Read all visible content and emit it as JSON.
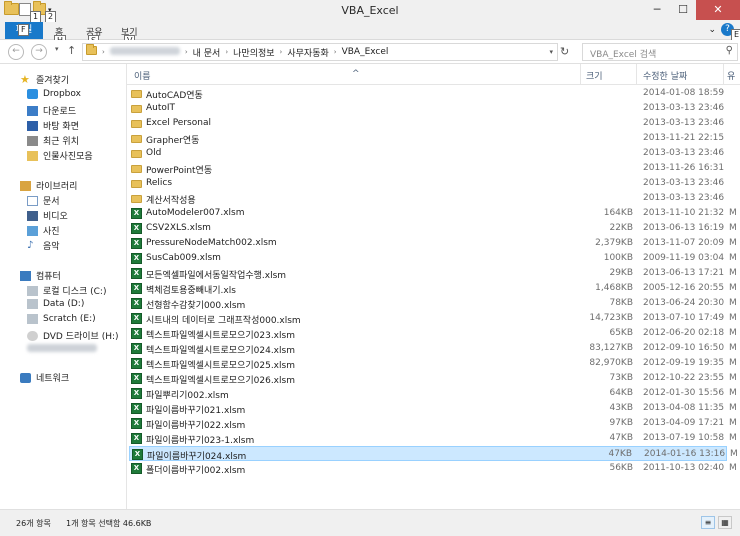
{
  "window": {
    "title": "VBA_Excel",
    "minimize": "─",
    "maximize": "☐",
    "close": "✕",
    "keytips": [
      "1",
      "2"
    ]
  },
  "ribbon": {
    "file_tab": "파일",
    "file_keytip": "F",
    "tabs": [
      {
        "label": "홈",
        "keytip": "H"
      },
      {
        "label": "공유",
        "keytip": "S"
      },
      {
        "label": "보기",
        "keytip": "V"
      }
    ],
    "help_keytip": "E"
  },
  "address": {
    "crumbs": [
      "내 문서",
      "나만의정보",
      "사무자동화",
      "VBA_Excel"
    ]
  },
  "search": {
    "placeholder": "VBA_Excel 검색"
  },
  "nav": {
    "favorites_header": "즐겨찾기",
    "favorites": [
      "Dropbox",
      "다운로드",
      "바탕 화면",
      "최근 위치",
      "인물사진모음"
    ],
    "libraries_header": "라이브러리",
    "libraries": [
      "문서",
      "비디오",
      "사진",
      "음악"
    ],
    "computer_header": "컴퓨터",
    "drives": [
      "로컬 디스크 (C:)",
      "Data (D:)",
      "Scratch (E:)",
      "DVD 드라이브 (H:)"
    ],
    "network": "네트워크"
  },
  "columns": {
    "name": "이름",
    "size": "크기",
    "date": "수정한 날짜",
    "type": "유"
  },
  "files": [
    {
      "name": "AutoCAD연동",
      "size": "",
      "date": "2014-01-08 18:59",
      "type": "",
      "kind": "folder"
    },
    {
      "name": "AutoIT",
      "size": "",
      "date": "2013-03-13 23:46",
      "type": "",
      "kind": "folder"
    },
    {
      "name": "Excel Personal",
      "size": "",
      "date": "2013-03-13 23:46",
      "type": "",
      "kind": "folder"
    },
    {
      "name": "Grapher연동",
      "size": "",
      "date": "2013-11-21 22:15",
      "type": "",
      "kind": "folder"
    },
    {
      "name": "Old",
      "size": "",
      "date": "2013-03-13 23:46",
      "type": "",
      "kind": "folder"
    },
    {
      "name": "PowerPoint연동",
      "size": "",
      "date": "2013-11-26 16:31",
      "type": "",
      "kind": "folder"
    },
    {
      "name": "Relics",
      "size": "",
      "date": "2013-03-13 23:46",
      "type": "",
      "kind": "folder"
    },
    {
      "name": "계산서작성용",
      "size": "",
      "date": "2013-03-13 23:46",
      "type": "",
      "kind": "folder"
    },
    {
      "name": "AutoModeler007.xlsm",
      "size": "164KB",
      "date": "2013-11-10 21:32",
      "type": "M",
      "kind": "excel"
    },
    {
      "name": "CSV2XLS.xlsm",
      "size": "22KB",
      "date": "2013-06-13 16:19",
      "type": "M",
      "kind": "excel"
    },
    {
      "name": "PressureNodeMatch002.xlsm",
      "size": "2,379KB",
      "date": "2013-11-07 20:09",
      "type": "M",
      "kind": "excel"
    },
    {
      "name": "SusCab009.xlsm",
      "size": "100KB",
      "date": "2009-11-19 03:04",
      "type": "M",
      "kind": "excel"
    },
    {
      "name": "모든엑셀파일에서동일작업수행.xlsm",
      "size": "29KB",
      "date": "2013-06-13 17:21",
      "type": "M",
      "kind": "excel"
    },
    {
      "name": "벽체검토용중빼내기.xls",
      "size": "1,468KB",
      "date": "2005-12-16 20:55",
      "type": "M",
      "kind": "excel"
    },
    {
      "name": "선형함수감찾기000.xlsm",
      "size": "78KB",
      "date": "2013-06-24 20:30",
      "type": "M",
      "kind": "excel"
    },
    {
      "name": "시트내의 데이터로 그래프작성000.xlsm",
      "size": "14,723KB",
      "date": "2013-07-10 17:49",
      "type": "M",
      "kind": "excel"
    },
    {
      "name": "텍스트파일엑셀시트로모으기023.xlsm",
      "size": "65KB",
      "date": "2012-06-20 02:18",
      "type": "M",
      "kind": "excel"
    },
    {
      "name": "텍스트파일엑셀시트로모으기024.xlsm",
      "size": "83,127KB",
      "date": "2012-09-10 16:50",
      "type": "M",
      "kind": "excel"
    },
    {
      "name": "텍스트파일엑셀시트로모으기025.xlsm",
      "size": "82,970KB",
      "date": "2012-09-19 19:35",
      "type": "M",
      "kind": "excel"
    },
    {
      "name": "텍스트파일엑셀시트로모으기026.xlsm",
      "size": "73KB",
      "date": "2012-10-22 23:55",
      "type": "M",
      "kind": "excel"
    },
    {
      "name": "파일뿌리기002.xlsm",
      "size": "64KB",
      "date": "2012-01-30 15:56",
      "type": "M",
      "kind": "excel"
    },
    {
      "name": "파일이름바꾸기021.xlsm",
      "size": "43KB",
      "date": "2013-04-08 11:35",
      "type": "M",
      "kind": "excel"
    },
    {
      "name": "파일이름바꾸기022.xlsm",
      "size": "97KB",
      "date": "2013-04-09 17:21",
      "type": "M",
      "kind": "excel"
    },
    {
      "name": "파일이름바꾸기023-1.xlsm",
      "size": "47KB",
      "date": "2013-07-19 10:58",
      "type": "M",
      "kind": "excel"
    },
    {
      "name": "파일이름바꾸기024.xlsm",
      "size": "47KB",
      "date": "2014-01-16 13:16",
      "type": "M",
      "kind": "excel",
      "selected": true
    },
    {
      "name": "폴더이름바꾸기002.xlsm",
      "size": "56KB",
      "date": "2011-10-13 02:40",
      "type": "M",
      "kind": "excel"
    }
  ],
  "status": {
    "count": "26개 항목",
    "selection": "1개 항목 선택함 46.6KB"
  },
  "colors": {
    "accent": "#1979ca",
    "selected_row": "#cce8ff",
    "folder": "#e8c15a",
    "excel": "#1f7a3a"
  }
}
